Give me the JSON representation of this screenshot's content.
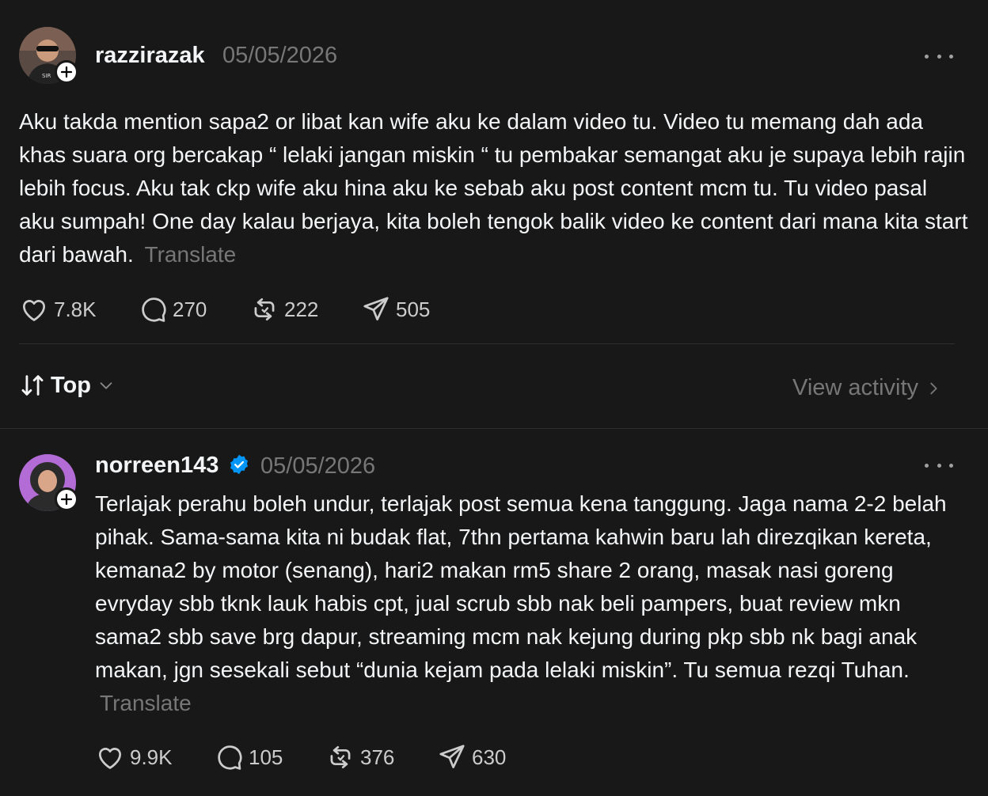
{
  "post": {
    "username": "razzirazak",
    "date": "05/05/2026",
    "text": "Aku takda mention sapa2 or libat kan wife aku ke dalam video tu. Video tu memang dah ada khas suara org bercakap “ lelaki jangan miskin “ tu pembakar semangat aku je supaya lebih rajin lebih focus. Aku tak ckp wife aku hina aku ke sebab aku post content mcm tu. Tu video pasal aku sumpah! One day kalau berjaya, kita boleh tengok balik video ke content dari mana kita start dari bawah.",
    "translate_label": "Translate",
    "likes": "7.8K",
    "comments": "270",
    "reposts": "222",
    "shares": "505"
  },
  "sort_bar": {
    "label": "Top",
    "view_activity_label": "View activity"
  },
  "reply": {
    "username": "norreen143",
    "verified": true,
    "date": "05/05/2026",
    "text": "Terlajak perahu boleh undur, terlajak post semua kena tanggung. Jaga nama 2-2 belah pihak. Sama-sama kita ni budak flat, 7thn pertama kahwin baru lah direzqikan kereta, kemana2 by motor (senang), hari2 makan rm5 share 2 orang, masak nasi goreng evryday sbb tknk lauk habis cpt, jual scrub sbb nak beli pampers, buat review mkn sama2 sbb save brg dapur, streaming mcm nak kejung during pkp sbb nk bagi anak makan, jgn sesekali sebut “dunia kejam pada lelaki miskin”. Tu semua rezqi Tuhan.",
    "translate_label": "Translate",
    "likes": "9.9K",
    "comments": "105",
    "reposts": "376",
    "shares": "630"
  },
  "icons": [
    "heart-icon",
    "comment-icon",
    "repost-icon",
    "share-icon",
    "more-icon",
    "plus-icon",
    "verified-icon",
    "sort-icon",
    "chevron-down-icon",
    "chevron-right-icon"
  ],
  "colors": {
    "background": "#181818",
    "text": "#f3f5f7",
    "muted": "#777777",
    "verified": "#0095f6"
  }
}
